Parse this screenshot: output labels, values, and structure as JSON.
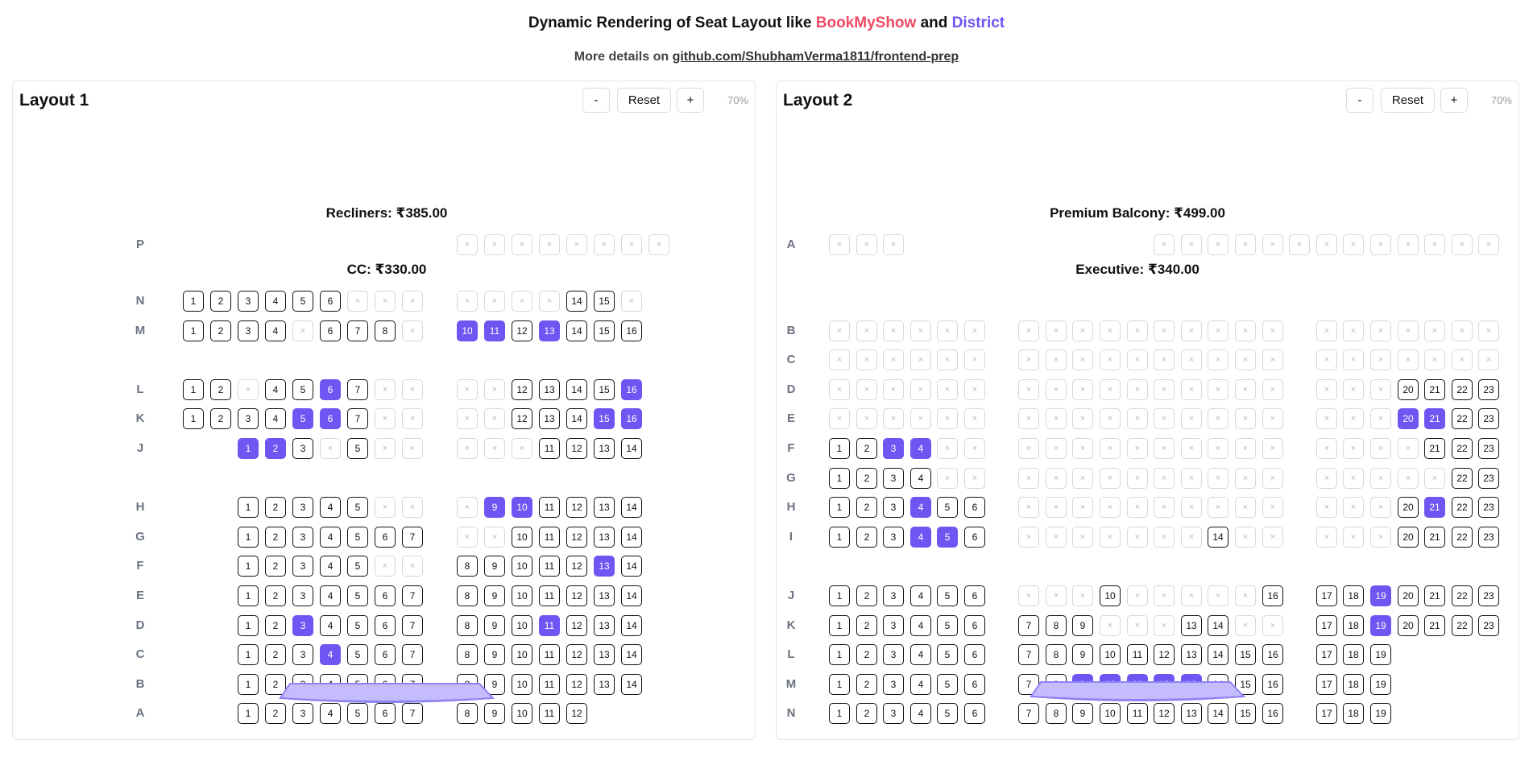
{
  "header": {
    "title_prefix": "Dynamic Rendering of Seat Layout like ",
    "brand1": "BookMyShow",
    "title_and": " and ",
    "brand2": "District",
    "brand1_color": "#ef4a62",
    "brand2_color": "#6d56f2",
    "details_prefix": "More details on ",
    "details_link": "github.com/ShubhamVerma1811/frontend-prep"
  },
  "layouts": [
    {
      "title": "Layout 1",
      "minus": "-",
      "reset": "Reset",
      "plus": "+",
      "zoom": "70%",
      "sections": [
        {
          "name": "Recliners: ₹385.00",
          "rows": [
            {
              "label": "P",
              "groups": [
                {
                  "start": 10,
                  "seats": "xxxxxxxx"
                }
              ]
            }
          ]
        },
        {
          "name": "CC: ₹330.00",
          "rows": [
            {
              "label": "N",
              "groups": [
                {
                  "start": 0,
                  "seats": "1 2 3 4 5 6 x x x"
                },
                {
                  "start": 10,
                  "seats": "x x x x 14 15 x"
                }
              ]
            },
            {
              "label": "M",
              "groups": [
                {
                  "start": 0,
                  "seats": "1 2 3 4 x 6 7 8 x"
                },
                {
                  "start": 10,
                  "seats": "*10 *11 12 *13 14 15 16"
                }
              ]
            },
            {
              "gap": true
            },
            {
              "label": "L",
              "groups": [
                {
                  "start": 0,
                  "seats": "1 2 x 4 5 *6 7 x x"
                },
                {
                  "start": 10,
                  "seats": "x x 12 13 14 15 *16"
                }
              ]
            },
            {
              "label": "K",
              "groups": [
                {
                  "start": 0,
                  "seats": "1 2 3 4 *5 *6 7 x x"
                },
                {
                  "start": 10,
                  "seats": "x x 12 13 14 *15 *16"
                }
              ]
            },
            {
              "label": "J",
              "groups": [
                {
                  "start": 2,
                  "seats": "*1 *2 3 x 5 x x"
                },
                {
                  "start": 10,
                  "seats": "x x x 11 12 13 14"
                }
              ]
            },
            {
              "gap": true
            },
            {
              "label": "H",
              "groups": [
                {
                  "start": 2,
                  "seats": "1 2 3 4 5 x x"
                },
                {
                  "start": 10,
                  "seats": "x *9 *10 11 12 13 14"
                }
              ]
            },
            {
              "label": "G",
              "groups": [
                {
                  "start": 2,
                  "seats": "1 2 3 4 5 6 7"
                },
                {
                  "start": 10,
                  "seats": "x x 10 11 12 13 14"
                }
              ]
            },
            {
              "label": "F",
              "groups": [
                {
                  "start": 2,
                  "seats": "1 2 3 4 5 x x"
                },
                {
                  "start": 10,
                  "seats": "8 9 10 11 12 *13 14"
                }
              ]
            },
            {
              "label": "E",
              "groups": [
                {
                  "start": 2,
                  "seats": "1 2 3 4 5 6 7"
                },
                {
                  "start": 10,
                  "seats": "8 9 10 11 12 13 14"
                }
              ]
            },
            {
              "label": "D",
              "groups": [
                {
                  "start": 2,
                  "seats": "1 2 *3 4 5 6 7"
                },
                {
                  "start": 10,
                  "seats": "8 9 10 *11 12 13 14"
                }
              ]
            },
            {
              "label": "C",
              "groups": [
                {
                  "start": 2,
                  "seats": "1 2 3 *4 5 6 7"
                },
                {
                  "start": 10,
                  "seats": "8 9 10 11 12 13 14"
                }
              ]
            },
            {
              "label": "B",
              "groups": [
                {
                  "start": 2,
                  "seats": "1 2 3 4 5 6 7"
                },
                {
                  "start": 10,
                  "seats": "8 9 10 11 12 13 14"
                }
              ]
            },
            {
              "label": "A",
              "groups": [
                {
                  "start": 2,
                  "seats": "1 2 3 4 5 6 7"
                },
                {
                  "start": 10,
                  "seats": "8 9 10 11 12"
                }
              ]
            }
          ]
        }
      ]
    },
    {
      "title": "Layout 2",
      "minus": "-",
      "reset": "Reset",
      "plus": "+",
      "zoom": "70%",
      "sections": [
        {
          "name": "Premium Balcony: ₹499.00",
          "rows": [
            {
              "label": "A",
              "groups": [
                {
                  "start": 0,
                  "seats": "x x x"
                },
                {
                  "start": 12,
                  "seats": "x x x x x x x x x x x x x"
                }
              ]
            }
          ]
        },
        {
          "name": "Executive: ₹340.00",
          "rows": [
            {
              "gap": true
            },
            {
              "label": "B",
              "groups": [
                {
                  "start": 0,
                  "seats": "x x x x x x"
                },
                {
                  "start": 7,
                  "seats": "x x x x x x x x x x"
                },
                {
                  "start": 18,
                  "seats": "x x x x x x x"
                }
              ]
            },
            {
              "label": "C",
              "groups": [
                {
                  "start": 0,
                  "seats": "x x x x x x"
                },
                {
                  "start": 7,
                  "seats": "x x x x x x x x x x"
                },
                {
                  "start": 18,
                  "seats": "x x x x x x x"
                }
              ]
            },
            {
              "label": "D",
              "groups": [
                {
                  "start": 0,
                  "seats": "x x x x x x"
                },
                {
                  "start": 7,
                  "seats": "x x x x x x x x x x"
                },
                {
                  "start": 18,
                  "seats": "x x x 20 21 22 23"
                }
              ]
            },
            {
              "label": "E",
              "groups": [
                {
                  "start": 0,
                  "seats": "x x x x x x"
                },
                {
                  "start": 7,
                  "seats": "x x x x x x x x x x"
                },
                {
                  "start": 18,
                  "seats": "x x x *20 *21 22 23"
                }
              ]
            },
            {
              "label": "F",
              "groups": [
                {
                  "start": 0,
                  "seats": "1 2 *3 *4 x x"
                },
                {
                  "start": 7,
                  "seats": "x x x x x x x x x x"
                },
                {
                  "start": 18,
                  "seats": "x x x x 21 22 23"
                }
              ]
            },
            {
              "label": "G",
              "groups": [
                {
                  "start": 0,
                  "seats": "1 2 3 4 x x"
                },
                {
                  "start": 7,
                  "seats": "x x x x x x x x x x"
                },
                {
                  "start": 18,
                  "seats": "x x x x x 22 23"
                }
              ]
            },
            {
              "label": "H",
              "groups": [
                {
                  "start": 0,
                  "seats": "1 2 3 *4 5 6"
                },
                {
                  "start": 7,
                  "seats": "x x x x x x x x x x"
                },
                {
                  "start": 18,
                  "seats": "x x x 20 *21 22 23"
                }
              ]
            },
            {
              "label": "I",
              "groups": [
                {
                  "start": 0,
                  "seats": "1 2 3 *4 *5 6"
                },
                {
                  "start": 7,
                  "seats": "x x x x x x x 14 x x"
                },
                {
                  "start": 18,
                  "seats": "x x x 20 21 22 23"
                }
              ]
            },
            {
              "gap": true
            },
            {
              "label": "J",
              "groups": [
                {
                  "start": 0,
                  "seats": "1 2 3 4 5 6"
                },
                {
                  "start": 7,
                  "seats": "x x x 10 x x x x x 16"
                },
                {
                  "start": 18,
                  "seats": "17 18 *19 20 21 22 23"
                }
              ]
            },
            {
              "label": "K",
              "groups": [
                {
                  "start": 0,
                  "seats": "1 2 3 4 5 6"
                },
                {
                  "start": 7,
                  "seats": "7 8 9 x x x 13 14 x x"
                },
                {
                  "start": 18,
                  "seats": "17 18 *19 20 21 22 23"
                }
              ]
            },
            {
              "label": "L",
              "groups": [
                {
                  "start": 0,
                  "seats": "1 2 3 4 5 6"
                },
                {
                  "start": 7,
                  "seats": "7 8 9 10 11 12 13 14 15 16"
                },
                {
                  "start": 18,
                  "seats": "17 18 19"
                }
              ]
            },
            {
              "label": "M",
              "groups": [
                {
                  "start": 0,
                  "seats": "1 2 3 4 5 6"
                },
                {
                  "start": 7,
                  "seats": "7 8 *9 *10 *11 *12 *13 14 15 16"
                },
                {
                  "start": 18,
                  "seats": "17 18 19"
                }
              ]
            },
            {
              "label": "N",
              "groups": [
                {
                  "start": 0,
                  "seats": "1 2 3 4 5 6"
                },
                {
                  "start": 7,
                  "seats": "7 8 9 10 11 12 13 14 15 16"
                },
                {
                  "start": 18,
                  "seats": "17 18 19"
                }
              ]
            }
          ]
        }
      ]
    }
  ]
}
